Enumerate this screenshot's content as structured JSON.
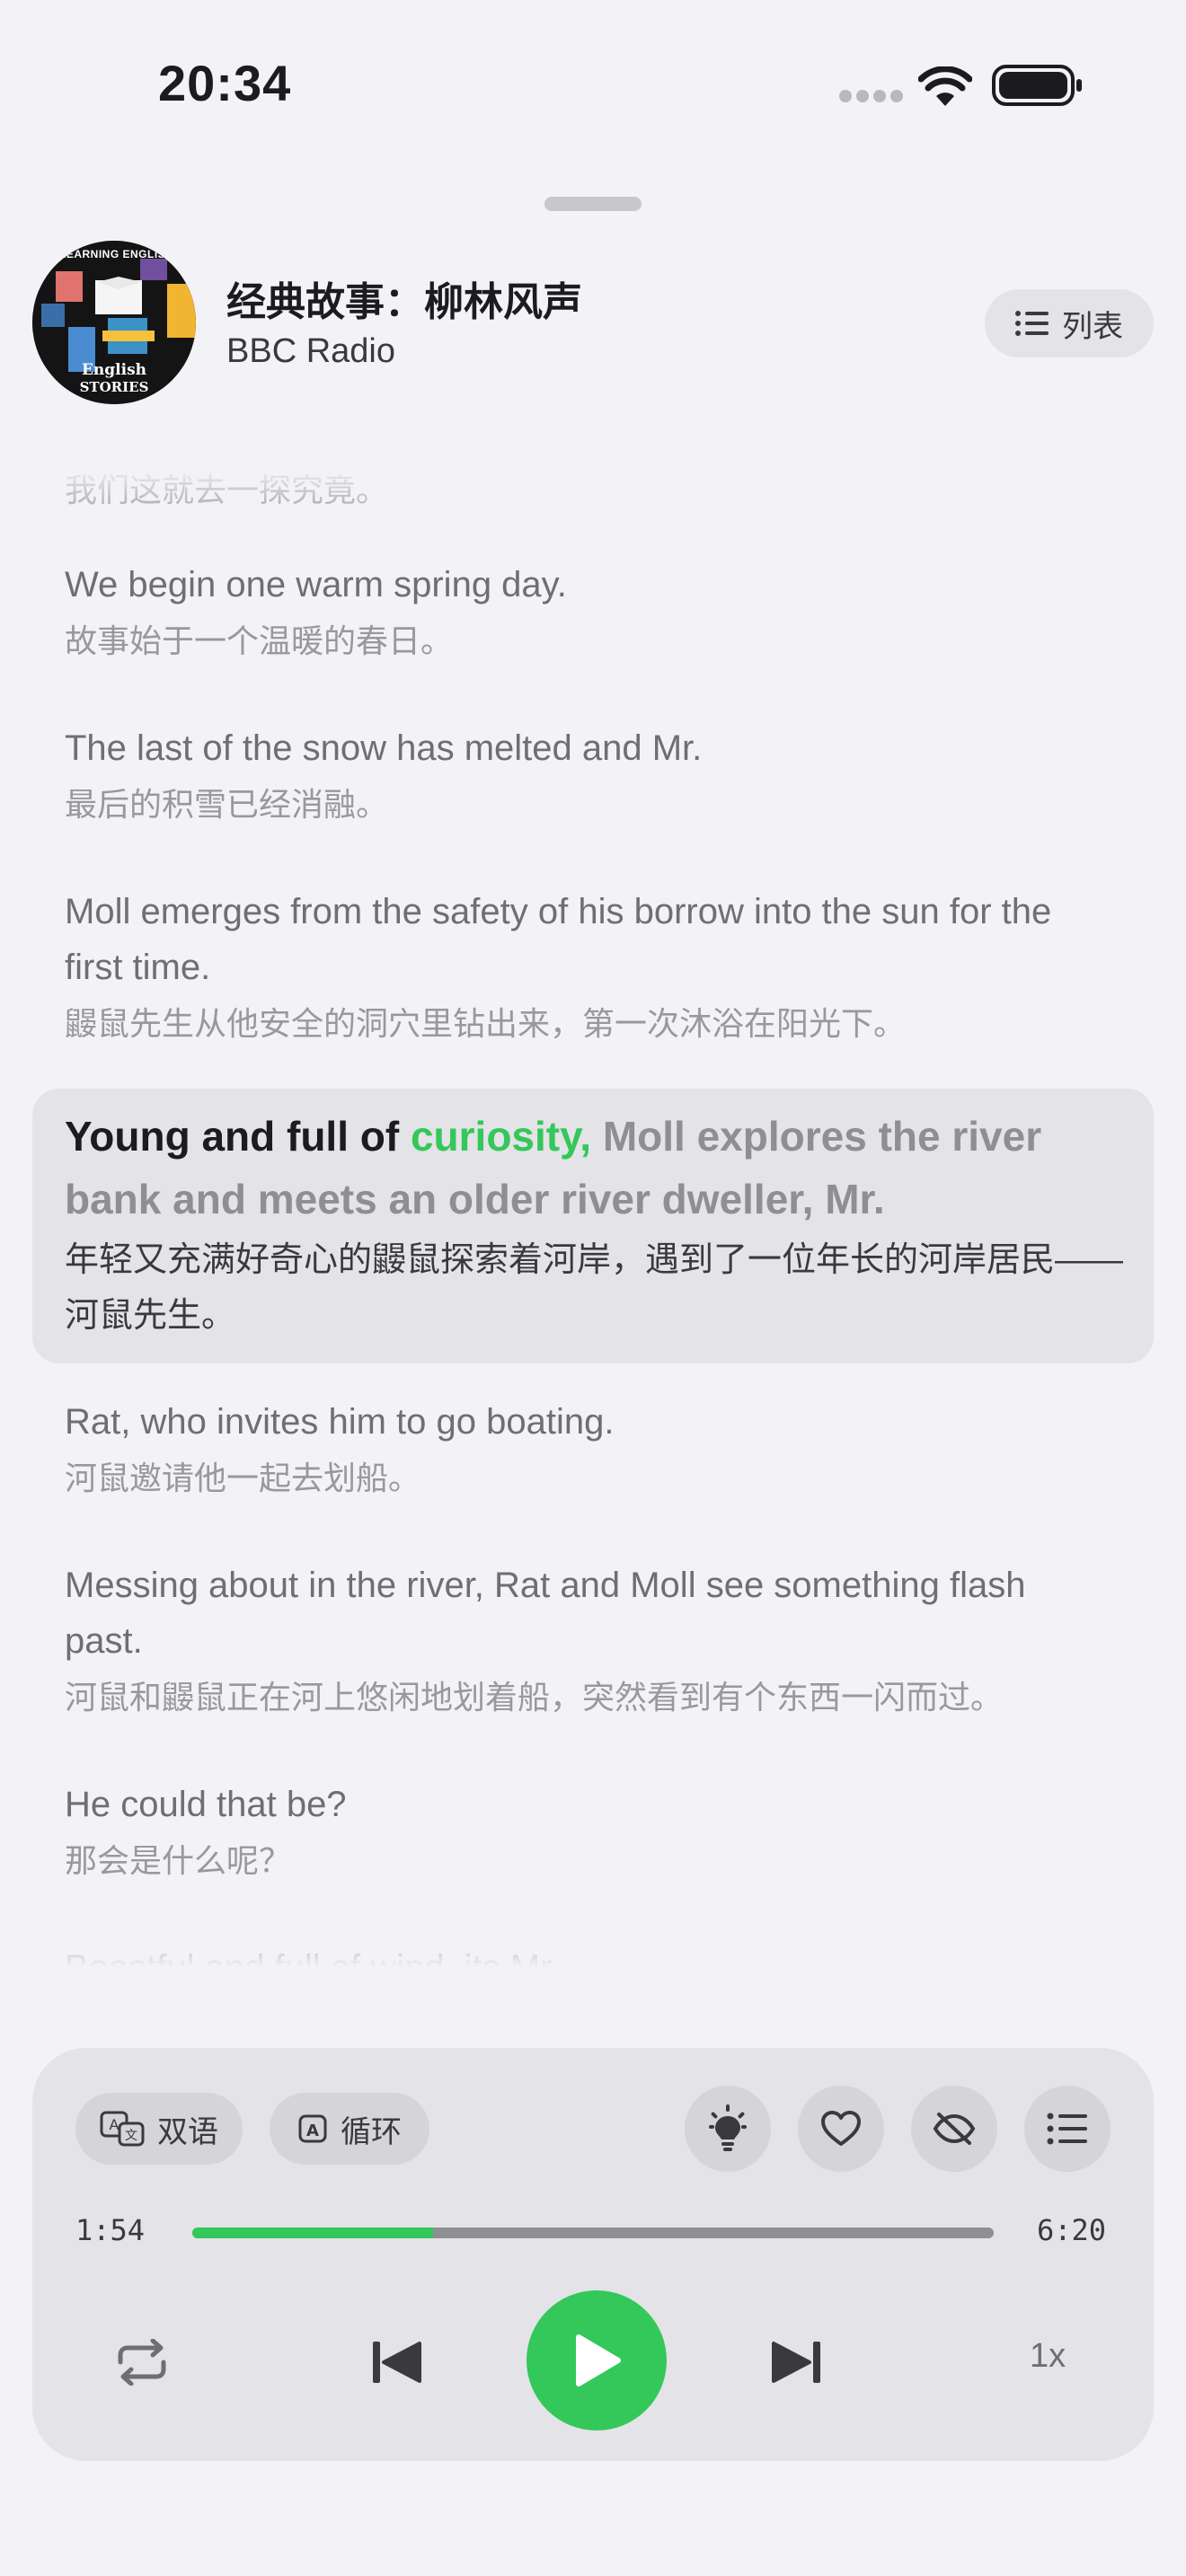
{
  "status_bar": {
    "time": "20:34"
  },
  "header": {
    "title": "经典故事：柳林风声",
    "subtitle": "BBC Radio",
    "list_button": "列表",
    "cover": {
      "top_text": "LEARNING ENGLISH",
      "text_line1": "English",
      "text_line2": "STORIES"
    }
  },
  "transcript": {
    "clipped_top_zh": "我们这就去一探究竟。",
    "segments": [
      {
        "en": "We begin one warm spring day.",
        "zh": "故事始于一个温暖的春日。"
      },
      {
        "en": "The last of the snow has melted and Mr.",
        "zh": "最后的积雪已经消融。"
      },
      {
        "en": "Moll emerges from the safety of his borrow into the sun for the first time.",
        "zh": "鼹鼠先生从他安全的洞穴里钻出来，第一次沐浴在阳光下。"
      }
    ],
    "active": {
      "en_spoken": "Young and full of ",
      "en_current": "curiosity,",
      "en_rest": " Moll explores the river bank and meets an older river dweller, Mr.",
      "zh": "年轻又充满好奇心的鼹鼠探索着河岸，遇到了一位年长的河岸居民——河鼠先生。"
    },
    "after": [
      {
        "en": "Rat, who invites him to go boating.",
        "zh": "河鼠邀请他一起去划船。"
      },
      {
        "en": "Messing about in the river, Rat and Moll see something flash past.",
        "zh": "河鼠和鼹鼠正在河上悠闲地划着船，突然看到有个东西一闪而过。"
      },
      {
        "en": "He could that be?",
        "zh": "那会是什么呢？"
      }
    ],
    "clipped_bottom_en": "Boastful and full of wind, its Mr."
  },
  "player": {
    "bilingual_label": "双语",
    "loop_label": "循环",
    "elapsed": "1:54",
    "total": "6:20",
    "progress": 0.3,
    "speed": "1x"
  },
  "colors": {
    "accent": "#34c759",
    "background": "#f2f2f7",
    "card": "#e3e3e8"
  }
}
